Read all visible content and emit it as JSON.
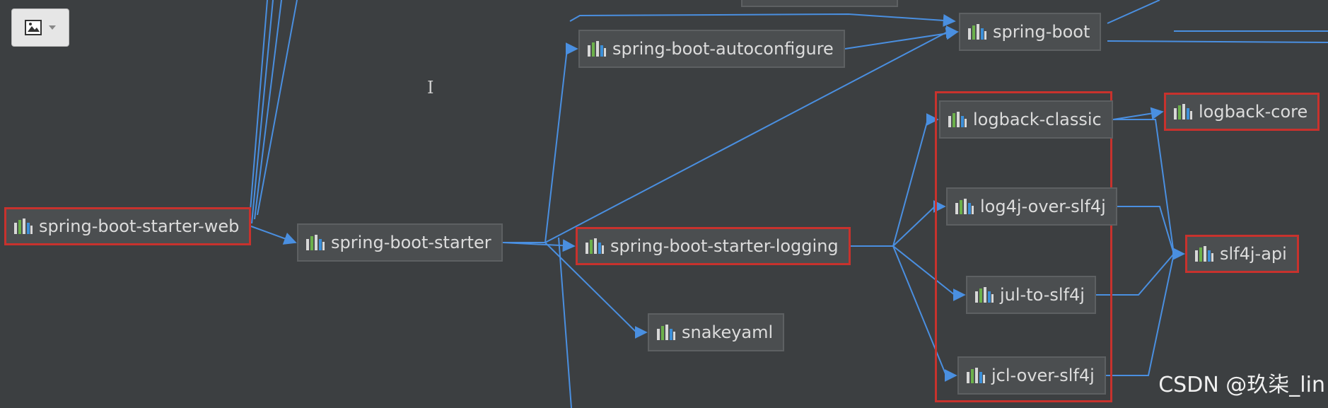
{
  "colors": {
    "background": "#3c3f41",
    "node_fill": "#4b4e50",
    "edge": "#4a8fe0",
    "highlight": "#c8322d"
  },
  "toolbar": {
    "icon": "image-icon",
    "dropdown_icon": "chevron-down-icon"
  },
  "nodes": [
    {
      "label": "spring-boot-starter-web",
      "highlighted": true
    },
    {
      "label": "spring-boot-starter",
      "highlighted": false
    },
    {
      "label": "spring-boot-autoconfigure",
      "highlighted": false
    },
    {
      "label": "spring-boot",
      "highlighted": false
    },
    {
      "label": "spring-boot-starter-logging",
      "highlighted": true
    },
    {
      "label": "snakeyaml",
      "highlighted": false
    },
    {
      "label": "logback-classic",
      "highlighted": false
    },
    {
      "label": "logback-core",
      "highlighted": true
    },
    {
      "label": "log4j-over-slf4j",
      "highlighted": false
    },
    {
      "label": "jul-to-slf4j",
      "highlighted": false
    },
    {
      "label": "jcl-over-slf4j",
      "highlighted": false
    },
    {
      "label": "slf4j-api",
      "highlighted": true
    }
  ],
  "edges": [
    [
      "spring-boot-starter-web",
      "spring-boot-starter"
    ],
    [
      "spring-boot-starter",
      "spring-boot-autoconfigure"
    ],
    [
      "spring-boot-starter",
      "spring-boot"
    ],
    [
      "spring-boot-starter",
      "spring-boot-starter-logging"
    ],
    [
      "spring-boot-starter",
      "snakeyaml"
    ],
    [
      "spring-boot-autoconfigure",
      "spring-boot"
    ],
    [
      "spring-boot-starter-logging",
      "logback-classic"
    ],
    [
      "spring-boot-starter-logging",
      "log4j-over-slf4j"
    ],
    [
      "spring-boot-starter-logging",
      "jul-to-slf4j"
    ],
    [
      "spring-boot-starter-logging",
      "jcl-over-slf4j"
    ],
    [
      "logback-classic",
      "logback-core"
    ],
    [
      "logback-classic",
      "slf4j-api"
    ],
    [
      "log4j-over-slf4j",
      "slf4j-api"
    ],
    [
      "jul-to-slf4j",
      "slf4j-api"
    ],
    [
      "jcl-over-slf4j",
      "slf4j-api"
    ]
  ],
  "group_box": {
    "members": [
      "logback-classic",
      "log4j-over-slf4j",
      "jul-to-slf4j",
      "jcl-over-slf4j"
    ]
  },
  "watermark": "CSDN @玖柒_lin"
}
